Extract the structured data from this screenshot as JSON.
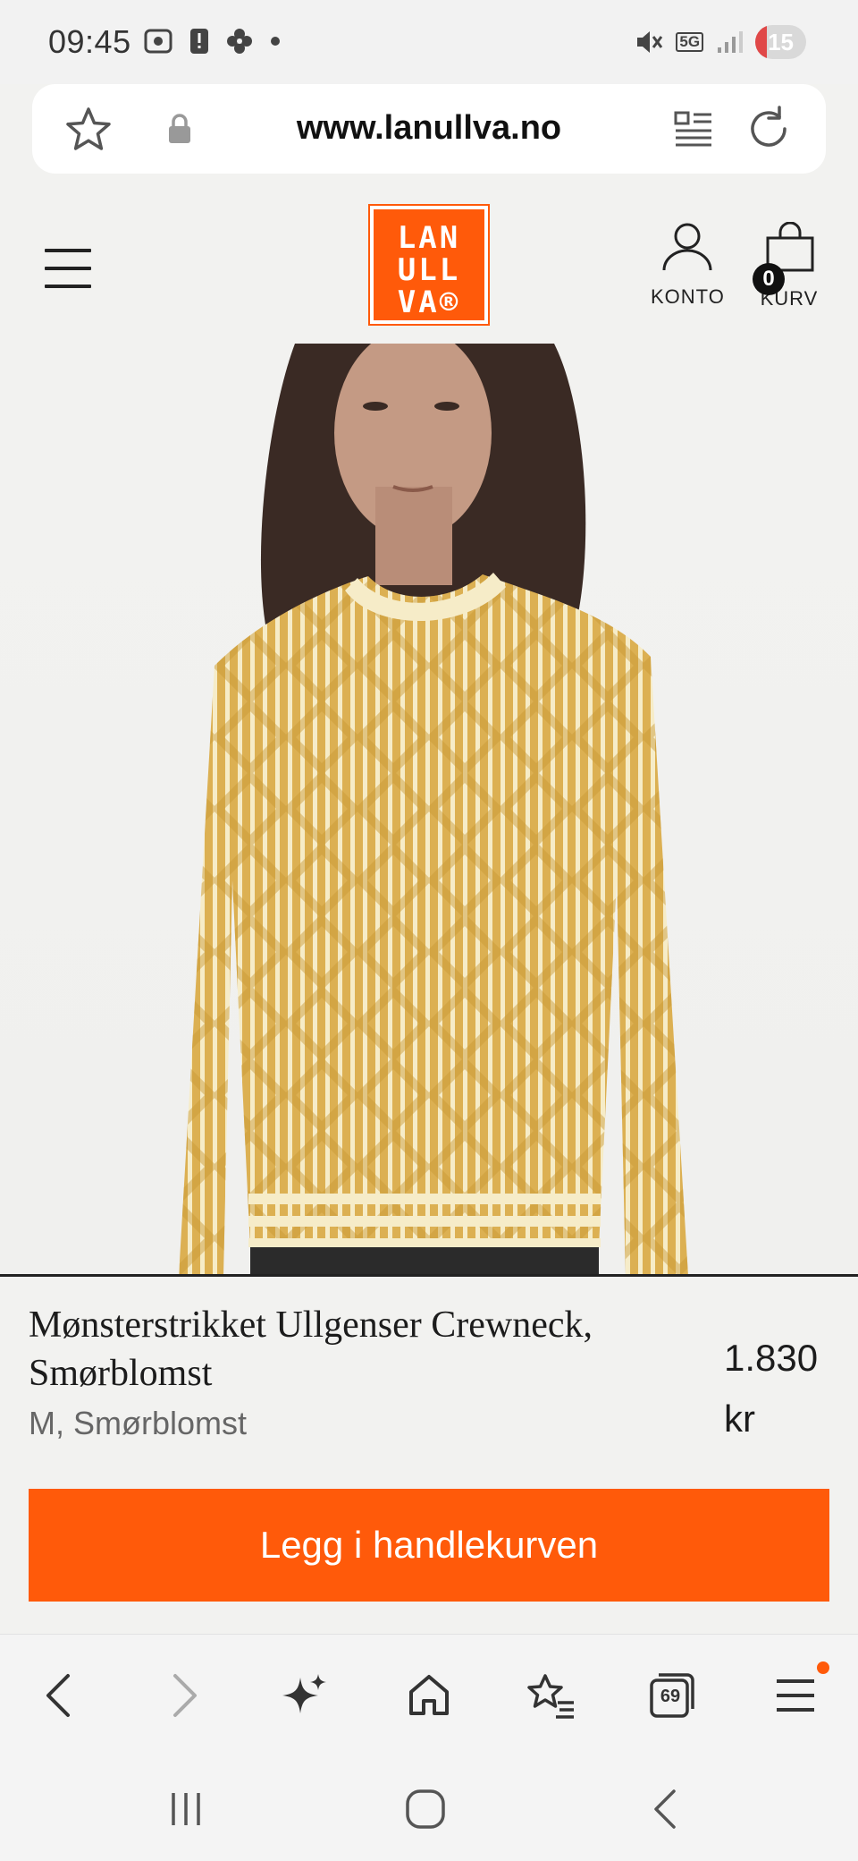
{
  "status_bar": {
    "time": "09:45",
    "network": "5G",
    "battery": "15",
    "battery_level_percent": 15,
    "icons_left": [
      "screenshot-icon",
      "alert-icon",
      "pinwheel-icon",
      "dot-icon"
    ],
    "icons_right": [
      "mute-icon",
      "5g-icon",
      "signal-icon",
      "battery-icon"
    ]
  },
  "browser": {
    "url": "www.lanullva.no",
    "tabs_count": "69"
  },
  "header": {
    "logo_lines": [
      "LAN",
      "ULL",
      "VA®"
    ],
    "account_label": "KONTO",
    "cart_label": "KURV",
    "cart_count": "0"
  },
  "product": {
    "title": "Mønsterstrikket Ullgenser Crewneck, Smørblomst",
    "variant": "M, Smørblomst",
    "price": "1.830 kr",
    "add_to_cart_label": "Legg i handlekurven"
  },
  "colors": {
    "brand": "#ff5a0a",
    "background": "#f2f2f0",
    "sweater": "#e0b85a"
  }
}
